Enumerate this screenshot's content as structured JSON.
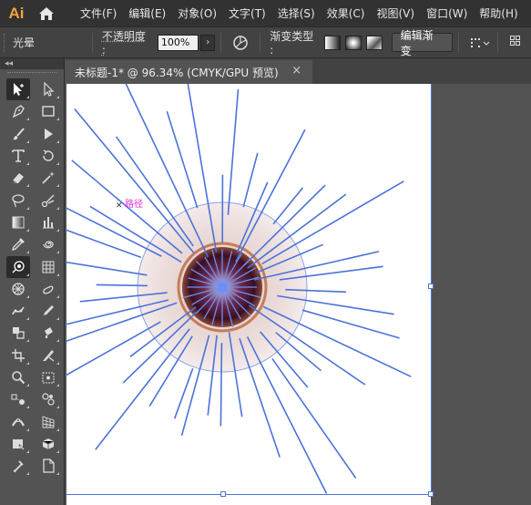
{
  "app": {
    "logo": "Ai",
    "home_icon": "home-icon"
  },
  "menu": [
    "文件(F)",
    "编辑(E)",
    "对象(O)",
    "文字(T)",
    "选择(S)",
    "效果(C)",
    "视图(V)",
    "窗口(W)",
    "帮助(H)"
  ],
  "controlbar": {
    "selection_name": "光晕",
    "opacity_label": "不透明度 :",
    "opacity_value": "100%",
    "gradient_type_label": "渐变类型 :",
    "edit_gradient_label": "编辑渐变"
  },
  "tools_panel": {
    "collapse_glyph": "◂◂"
  },
  "document": {
    "tab_title": "未标题-1* @ 96.34% (CMYK/GPU 预览)",
    "close_glyph": "×"
  },
  "canvas": {
    "path_label": "路径"
  },
  "colors": {
    "selection_blue": "#4b73d8",
    "app_logo": "#f7a23c",
    "path_label": "#e62dd6"
  }
}
